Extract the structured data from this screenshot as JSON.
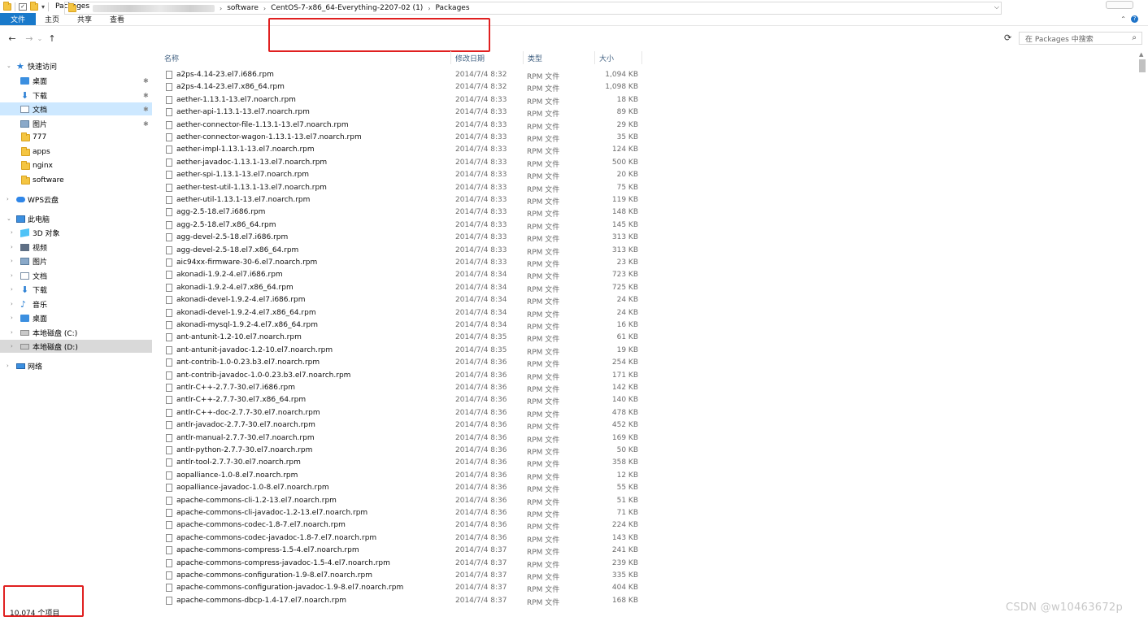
{
  "window": {
    "title": "Packages"
  },
  "ribbon": {
    "tabs": [
      "文件",
      "主页",
      "共享",
      "查看"
    ]
  },
  "nav": {
    "back": "←",
    "forward": "→",
    "recent": "⌄",
    "up": "↑"
  },
  "address": {
    "crumbs": [
      "software",
      "CentOS-7-x86_64-Everything-2207-02 (1)",
      "Packages"
    ],
    "separator": "›"
  },
  "search": {
    "placeholder": "在 Packages 中搜索"
  },
  "sidebar": {
    "quick_access": "快速访问",
    "quick_items": [
      "桌面",
      "下载",
      "文档",
      "图片",
      "777",
      "apps",
      "nginx",
      "software"
    ],
    "wps": "WPS云盘",
    "this_pc": "此电脑",
    "pc_items": [
      "3D 对象",
      "视频",
      "图片",
      "文档",
      "下载",
      "音乐",
      "桌面",
      "本地磁盘 (C:)",
      "本地磁盘 (D:)"
    ],
    "network": "网络"
  },
  "columns": {
    "name": "名称",
    "date": "修改日期",
    "type": "类型",
    "size": "大小"
  },
  "files": [
    {
      "name": "a2ps-4.14-23.el7.i686.rpm",
      "date": "2014/7/4 8:32",
      "type": "RPM 文件",
      "size": "1,094 KB"
    },
    {
      "name": "a2ps-4.14-23.el7.x86_64.rpm",
      "date": "2014/7/4 8:32",
      "type": "RPM 文件",
      "size": "1,098 KB"
    },
    {
      "name": "aether-1.13.1-13.el7.noarch.rpm",
      "date": "2014/7/4 8:33",
      "type": "RPM 文件",
      "size": "18 KB"
    },
    {
      "name": "aether-api-1.13.1-13.el7.noarch.rpm",
      "date": "2014/7/4 8:33",
      "type": "RPM 文件",
      "size": "89 KB"
    },
    {
      "name": "aether-connector-file-1.13.1-13.el7.noarch.rpm",
      "date": "2014/7/4 8:33",
      "type": "RPM 文件",
      "size": "29 KB"
    },
    {
      "name": "aether-connector-wagon-1.13.1-13.el7.noarch.rpm",
      "date": "2014/7/4 8:33",
      "type": "RPM 文件",
      "size": "35 KB"
    },
    {
      "name": "aether-impl-1.13.1-13.el7.noarch.rpm",
      "date": "2014/7/4 8:33",
      "type": "RPM 文件",
      "size": "124 KB"
    },
    {
      "name": "aether-javadoc-1.13.1-13.el7.noarch.rpm",
      "date": "2014/7/4 8:33",
      "type": "RPM 文件",
      "size": "500 KB"
    },
    {
      "name": "aether-spi-1.13.1-13.el7.noarch.rpm",
      "date": "2014/7/4 8:33",
      "type": "RPM 文件",
      "size": "20 KB"
    },
    {
      "name": "aether-test-util-1.13.1-13.el7.noarch.rpm",
      "date": "2014/7/4 8:33",
      "type": "RPM 文件",
      "size": "75 KB"
    },
    {
      "name": "aether-util-1.13.1-13.el7.noarch.rpm",
      "date": "2014/7/4 8:33",
      "type": "RPM 文件",
      "size": "119 KB"
    },
    {
      "name": "agg-2.5-18.el7.i686.rpm",
      "date": "2014/7/4 8:33",
      "type": "RPM 文件",
      "size": "148 KB"
    },
    {
      "name": "agg-2.5-18.el7.x86_64.rpm",
      "date": "2014/7/4 8:33",
      "type": "RPM 文件",
      "size": "145 KB"
    },
    {
      "name": "agg-devel-2.5-18.el7.i686.rpm",
      "date": "2014/7/4 8:33",
      "type": "RPM 文件",
      "size": "313 KB"
    },
    {
      "name": "agg-devel-2.5-18.el7.x86_64.rpm",
      "date": "2014/7/4 8:33",
      "type": "RPM 文件",
      "size": "313 KB"
    },
    {
      "name": "aic94xx-firmware-30-6.el7.noarch.rpm",
      "date": "2014/7/4 8:33",
      "type": "RPM 文件",
      "size": "23 KB"
    },
    {
      "name": "akonadi-1.9.2-4.el7.i686.rpm",
      "date": "2014/7/4 8:34",
      "type": "RPM 文件",
      "size": "723 KB"
    },
    {
      "name": "akonadi-1.9.2-4.el7.x86_64.rpm",
      "date": "2014/7/4 8:34",
      "type": "RPM 文件",
      "size": "725 KB"
    },
    {
      "name": "akonadi-devel-1.9.2-4.el7.i686.rpm",
      "date": "2014/7/4 8:34",
      "type": "RPM 文件",
      "size": "24 KB"
    },
    {
      "name": "akonadi-devel-1.9.2-4.el7.x86_64.rpm",
      "date": "2014/7/4 8:34",
      "type": "RPM 文件",
      "size": "24 KB"
    },
    {
      "name": "akonadi-mysql-1.9.2-4.el7.x86_64.rpm",
      "date": "2014/7/4 8:34",
      "type": "RPM 文件",
      "size": "16 KB"
    },
    {
      "name": "ant-antunit-1.2-10.el7.noarch.rpm",
      "date": "2014/7/4 8:35",
      "type": "RPM 文件",
      "size": "61 KB"
    },
    {
      "name": "ant-antunit-javadoc-1.2-10.el7.noarch.rpm",
      "date": "2014/7/4 8:35",
      "type": "RPM 文件",
      "size": "19 KB"
    },
    {
      "name": "ant-contrib-1.0-0.23.b3.el7.noarch.rpm",
      "date": "2014/7/4 8:36",
      "type": "RPM 文件",
      "size": "254 KB"
    },
    {
      "name": "ant-contrib-javadoc-1.0-0.23.b3.el7.noarch.rpm",
      "date": "2014/7/4 8:36",
      "type": "RPM 文件",
      "size": "171 KB"
    },
    {
      "name": "antlr-C++-2.7.7-30.el7.i686.rpm",
      "date": "2014/7/4 8:36",
      "type": "RPM 文件",
      "size": "142 KB"
    },
    {
      "name": "antlr-C++-2.7.7-30.el7.x86_64.rpm",
      "date": "2014/7/4 8:36",
      "type": "RPM 文件",
      "size": "140 KB"
    },
    {
      "name": "antlr-C++-doc-2.7.7-30.el7.noarch.rpm",
      "date": "2014/7/4 8:36",
      "type": "RPM 文件",
      "size": "478 KB"
    },
    {
      "name": "antlr-javadoc-2.7.7-30.el7.noarch.rpm",
      "date": "2014/7/4 8:36",
      "type": "RPM 文件",
      "size": "452 KB"
    },
    {
      "name": "antlr-manual-2.7.7-30.el7.noarch.rpm",
      "date": "2014/7/4 8:36",
      "type": "RPM 文件",
      "size": "169 KB"
    },
    {
      "name": "antlr-python-2.7.7-30.el7.noarch.rpm",
      "date": "2014/7/4 8:36",
      "type": "RPM 文件",
      "size": "50 KB"
    },
    {
      "name": "antlr-tool-2.7.7-30.el7.noarch.rpm",
      "date": "2014/7/4 8:36",
      "type": "RPM 文件",
      "size": "358 KB"
    },
    {
      "name": "aopalliance-1.0-8.el7.noarch.rpm",
      "date": "2014/7/4 8:36",
      "type": "RPM 文件",
      "size": "12 KB"
    },
    {
      "name": "aopalliance-javadoc-1.0-8.el7.noarch.rpm",
      "date": "2014/7/4 8:36",
      "type": "RPM 文件",
      "size": "55 KB"
    },
    {
      "name": "apache-commons-cli-1.2-13.el7.noarch.rpm",
      "date": "2014/7/4 8:36",
      "type": "RPM 文件",
      "size": "51 KB"
    },
    {
      "name": "apache-commons-cli-javadoc-1.2-13.el7.noarch.rpm",
      "date": "2014/7/4 8:36",
      "type": "RPM 文件",
      "size": "71 KB"
    },
    {
      "name": "apache-commons-codec-1.8-7.el7.noarch.rpm",
      "date": "2014/7/4 8:36",
      "type": "RPM 文件",
      "size": "224 KB"
    },
    {
      "name": "apache-commons-codec-javadoc-1.8-7.el7.noarch.rpm",
      "date": "2014/7/4 8:36",
      "type": "RPM 文件",
      "size": "143 KB"
    },
    {
      "name": "apache-commons-compress-1.5-4.el7.noarch.rpm",
      "date": "2014/7/4 8:37",
      "type": "RPM 文件",
      "size": "241 KB"
    },
    {
      "name": "apache-commons-compress-javadoc-1.5-4.el7.noarch.rpm",
      "date": "2014/7/4 8:37",
      "type": "RPM 文件",
      "size": "239 KB"
    },
    {
      "name": "apache-commons-configuration-1.9-8.el7.noarch.rpm",
      "date": "2014/7/4 8:37",
      "type": "RPM 文件",
      "size": "335 KB"
    },
    {
      "name": "apache-commons-configuration-javadoc-1.9-8.el7.noarch.rpm",
      "date": "2014/7/4 8:37",
      "type": "RPM 文件",
      "size": "404 KB"
    },
    {
      "name": "apache-commons-dbcp-1.4-17.el7.noarch.rpm",
      "date": "2014/7/4 8:37",
      "type": "RPM 文件",
      "size": "168 KB"
    }
  ],
  "status": {
    "count": "10,074 个项目"
  },
  "watermark": "CSDN @w10463672p",
  "colors": {
    "accent": "#1979ca",
    "highlight": "#e02020",
    "selection": "#cde8ff"
  }
}
